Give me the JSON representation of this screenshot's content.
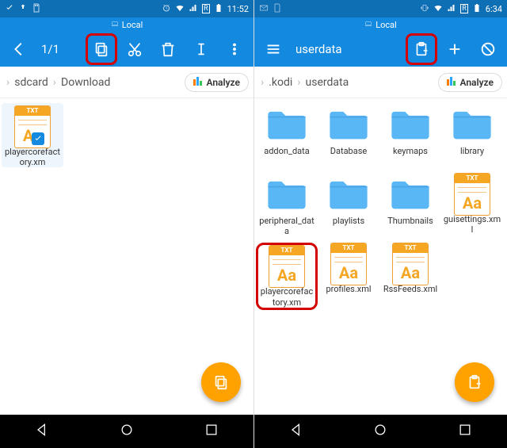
{
  "left": {
    "status": {
      "time": "11:52"
    },
    "titlestrip": "Local",
    "toolbar": {
      "counter": "1/1"
    },
    "breadcrumb": [
      "sdcard",
      "Download"
    ],
    "analyze_label": "Analyze",
    "items": [
      {
        "type": "txt",
        "label": "playercorefactory.xm",
        "selected": true
      }
    ]
  },
  "right": {
    "status": {
      "time": "6:34"
    },
    "titlestrip": "Local",
    "toolbar": {
      "path_label": "userdata"
    },
    "breadcrumb": [
      ".kodi",
      "userdata"
    ],
    "analyze_label": "Analyze",
    "items": [
      {
        "type": "folder",
        "label": "addon_data"
      },
      {
        "type": "folder",
        "label": "Database"
      },
      {
        "type": "folder",
        "label": "keymaps"
      },
      {
        "type": "folder",
        "label": "library"
      },
      {
        "type": "folder",
        "label": "peripheral_data"
      },
      {
        "type": "folder",
        "label": "playlists"
      },
      {
        "type": "folder",
        "label": "Thumbnails"
      },
      {
        "type": "txt",
        "label": "guisettings.xml"
      },
      {
        "type": "txt",
        "label": "playercorefactory.xm",
        "ringed": true
      },
      {
        "type": "txt",
        "label": "profiles.xml"
      },
      {
        "type": "txt",
        "label": "RssFeeds.xml"
      }
    ]
  },
  "txt_badge": "TXT",
  "txt_glyph": "Aa"
}
